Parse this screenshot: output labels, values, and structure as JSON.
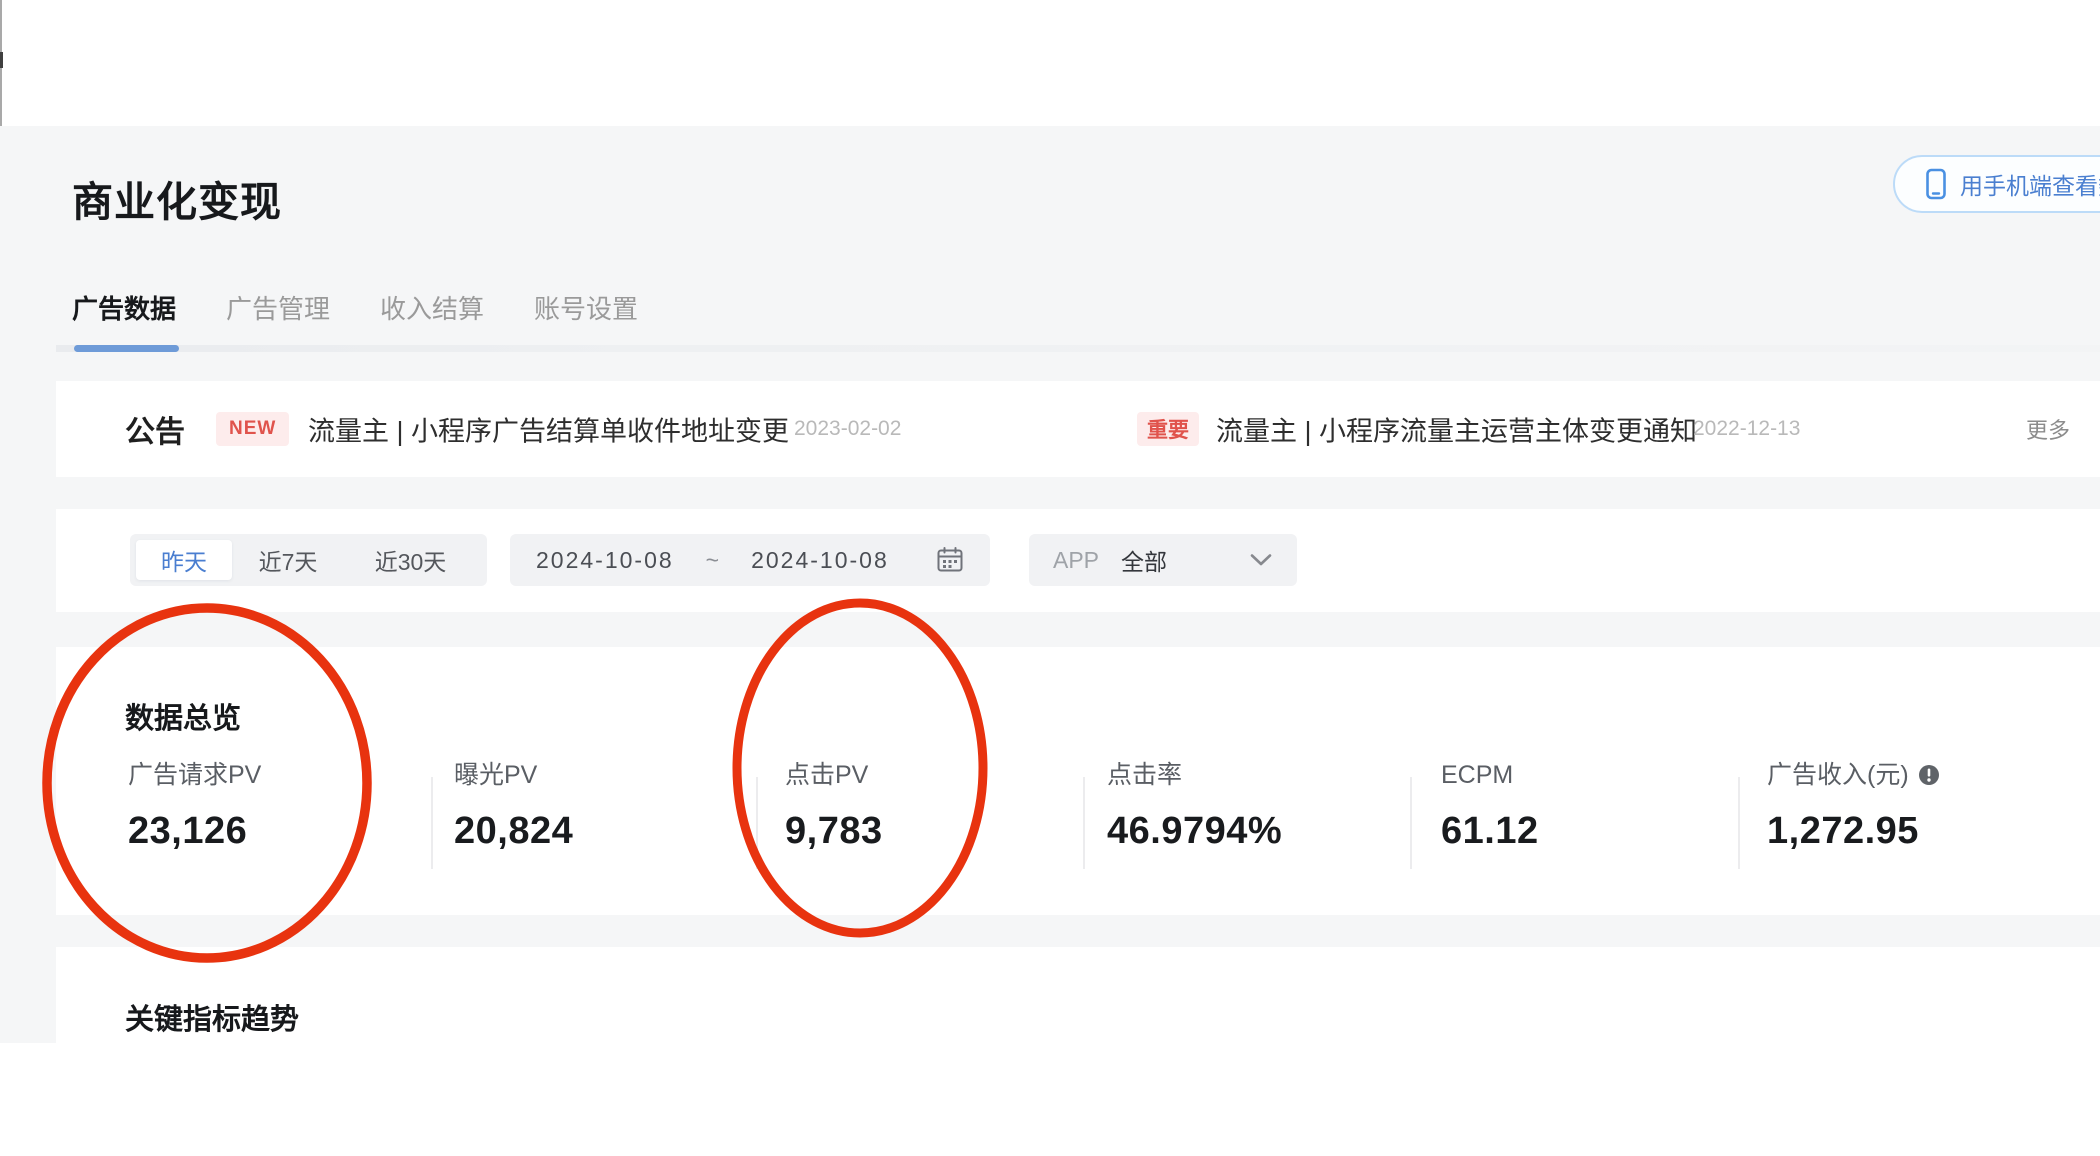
{
  "page": {
    "title": "商业化变现",
    "mobile_button_label": "用手机端查看数据"
  },
  "tabs": {
    "items": [
      {
        "label": "广告数据",
        "active": true
      },
      {
        "label": "广告管理",
        "active": false
      },
      {
        "label": "收入结算",
        "active": false
      },
      {
        "label": "账号设置",
        "active": false
      }
    ]
  },
  "announcements": {
    "heading": "公告",
    "more_label": "更多",
    "items": [
      {
        "badge": "NEW",
        "title": "流量主 | 小程序广告结算单收件地址变更",
        "date": "2023-02-02"
      },
      {
        "badge": "重要",
        "title": "流量主 | 小程序流量主运营主体变更通知",
        "date": "2022-12-13"
      }
    ]
  },
  "filters": {
    "quick_ranges": [
      {
        "label": "昨天",
        "selected": true
      },
      {
        "label": "近7天",
        "selected": false
      },
      {
        "label": "近30天",
        "selected": false
      }
    ],
    "date_start": "2024-10-08",
    "date_separator": "~",
    "date_end": "2024-10-08",
    "app_label": "APP",
    "app_value": "全部"
  },
  "overview": {
    "heading": "数据总览",
    "metrics": [
      {
        "label": "广告请求PV",
        "value": "23,126",
        "circled": true,
        "info_icon": false
      },
      {
        "label": "曝光PV",
        "value": "20,824",
        "circled": false,
        "info_icon": false
      },
      {
        "label": "点击PV",
        "value": "9,783",
        "circled": true,
        "info_icon": false
      },
      {
        "label": "点击率",
        "value": "46.9794%",
        "circled": false,
        "info_icon": false
      },
      {
        "label": "ECPM",
        "value": "61.12",
        "circled": false,
        "info_icon": false
      },
      {
        "label": "广告收入(元)",
        "value": "1,272.95",
        "circled": false,
        "info_icon": true
      }
    ]
  },
  "trend": {
    "heading": "关键指标趋势"
  },
  "colors": {
    "accent_blue": "#6e9bd8",
    "link_blue": "#4a7fd0",
    "badge_red": "#e0534c",
    "badge_bg": "#fdecec",
    "annotation_red": "#e8330f",
    "page_gray": "#f5f6f7",
    "box_gray": "#f1f2f4"
  }
}
